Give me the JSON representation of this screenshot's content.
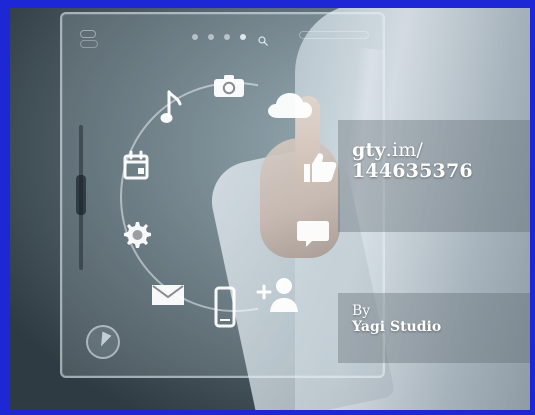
{
  "watermark": {
    "url_prefix": "gty",
    "url_suffix": ".im/",
    "code": "144635376",
    "by_label": "By",
    "studio_name": "Yagi Studio"
  },
  "colors": {
    "border_blue": "#1d27d6",
    "panel_glass": "#d2e1eb",
    "icon_white": "#ffffff"
  },
  "icons": [
    "music-note-icon",
    "camera-icon",
    "cloud-icon",
    "calendar-icon",
    "like-thumb-icon",
    "gear-icon",
    "chat-bubble-icon",
    "mail-icon",
    "phone-icon",
    "add-contact-icon",
    "search-icon",
    "compass-icon"
  ]
}
